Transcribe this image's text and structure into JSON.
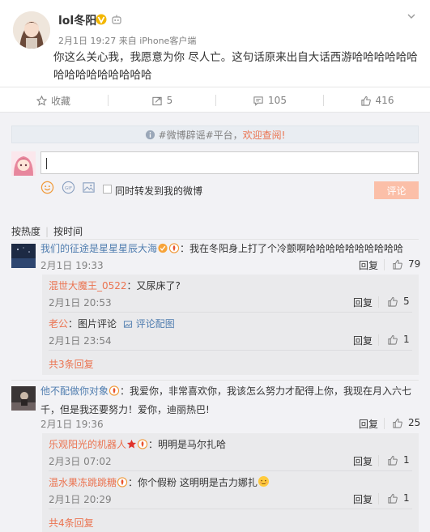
{
  "post": {
    "username": "lol冬阳",
    "time": "2月1日 19:27",
    "source": "来自 iPhone客户端",
    "text": "你这么关心我，我愿意为你   尽人亡。这句话原来出自大话西游哈哈哈哈哈哈哈哈哈哈哈哈哈哈哈"
  },
  "actions": {
    "favorite": "收藏",
    "repost": "5",
    "comment": "105",
    "like": "416"
  },
  "composer": {
    "notice_prefix": "#微博辟谣#平台，",
    "notice_link": "欢迎查阅!",
    "checkbox_label": "同时转发到我的微博",
    "submit": "评论"
  },
  "sort": {
    "hot": "按热度",
    "time": "按时间"
  },
  "comments": [
    {
      "name": "我们的征途是星星星辰大海",
      "text": "：我在冬阳身上打了个冷颤啊哈哈哈哈哈哈哈哈哈哈",
      "time": "2月1日 19:33",
      "reply": "回复",
      "likes": "79",
      "replies": [
        {
          "name": "混世大魔王_0522",
          "text": "：又尿床了?",
          "time": "2月1日 20:53",
          "reply": "回复",
          "likes": "5"
        },
        {
          "name": "老公",
          "text": "：图片评论",
          "link": "评论配图",
          "time": "2月1日 23:54",
          "reply": "回复",
          "likes": "1"
        }
      ],
      "more": "共3条回复"
    },
    {
      "name": "他不配做你对象",
      "text_line1": "：我爱你，非常喜欢你，我该怎么努力才配得上你，我现在月入六七",
      "text_line2": "千，但是我还要努力！爱你，迪丽热巴!",
      "time": "2月1日 19:36",
      "reply": "回复",
      "likes": "25",
      "replies": [
        {
          "name": "乐观阳光的机器人",
          "text": "：明明是马尔扎哈",
          "time": "2月3日 07:02",
          "reply": "回复",
          "likes": "1"
        },
        {
          "name": "温水果冻跳跳糖",
          "text": "：你个假粉 这明明是古力娜扎",
          "time": "2月1日 20:29",
          "reply": "回复",
          "likes": "1"
        }
      ],
      "more": "共4条回复"
    }
  ],
  "colors": {
    "accent": "#eb7350",
    "submit_bg": "#fbbfa8",
    "panel_bg": "#f2f2f5",
    "gold": "#f3b700"
  }
}
